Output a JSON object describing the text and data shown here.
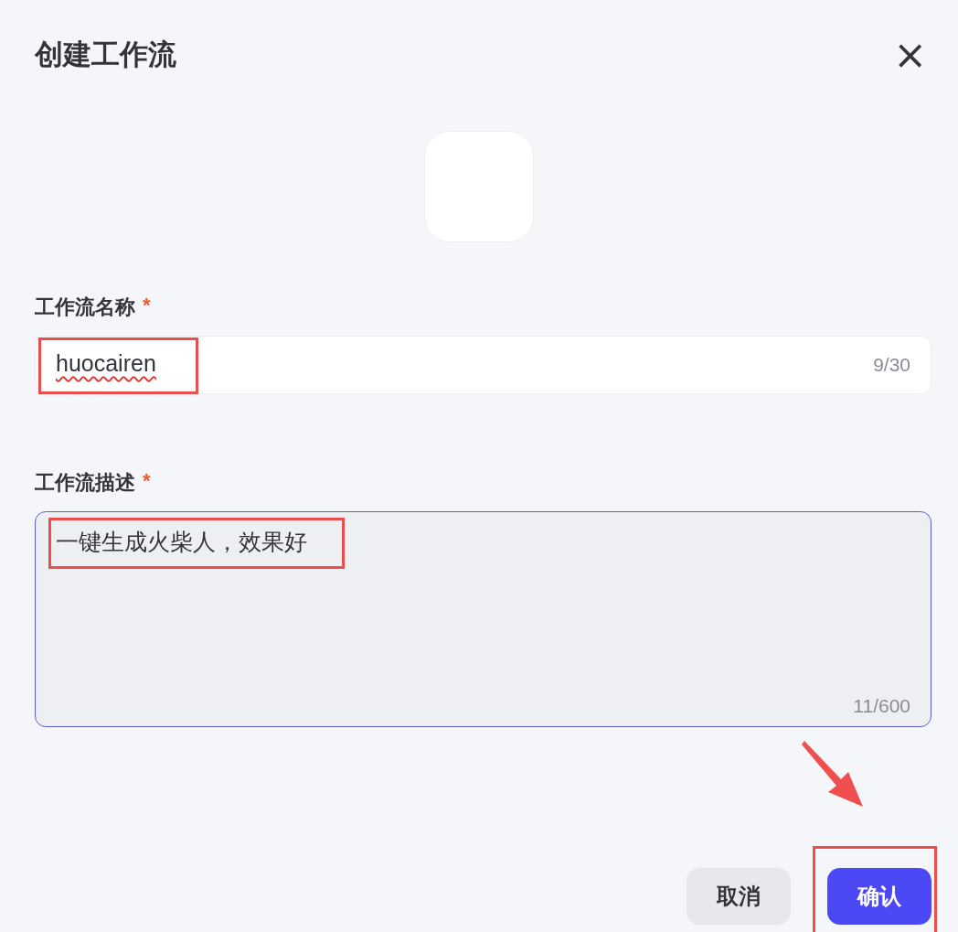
{
  "dialog": {
    "title": "创建工作流",
    "close": "×"
  },
  "fields": [
    {
      "kind": "input",
      "label": "工作流名称",
      "required_mark": "*",
      "value": "huocairen",
      "counter": "9/30",
      "spelling_error": true,
      "focused": false
    },
    {
      "kind": "textarea",
      "label": "工作流描述",
      "required_mark": "*",
      "value": "一键生成火柴人，效果好",
      "counter": "11/600",
      "focused": true
    }
  ],
  "buttons": [
    {
      "label": "取消",
      "kind": "secondary"
    },
    {
      "label": "确认",
      "kind": "primary"
    }
  ]
}
